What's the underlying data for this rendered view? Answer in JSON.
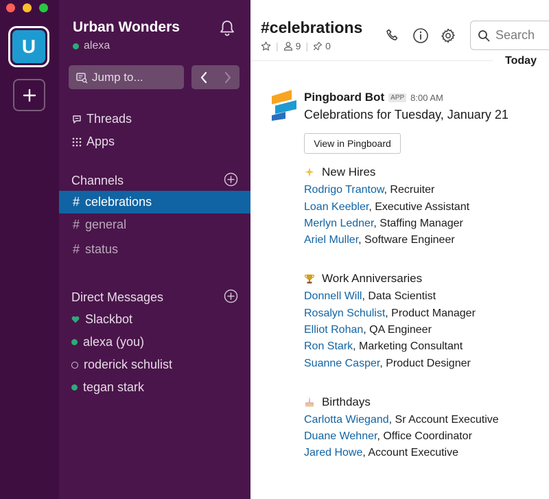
{
  "workspace": {
    "initial": "U",
    "name": "Urban Wonders",
    "user": "alexa"
  },
  "sidebar": {
    "jump_label": "Jump to...",
    "threads_label": "Threads",
    "apps_label": "Apps",
    "channels_title": "Channels",
    "channels": [
      {
        "name": "celebrations",
        "active": true
      },
      {
        "name": "general",
        "active": false
      },
      {
        "name": "status",
        "active": false
      }
    ],
    "dm_title": "Direct Messages",
    "dms": [
      {
        "name": "Slackbot",
        "status": "heart"
      },
      {
        "name": "alexa  (you)",
        "status": "online"
      },
      {
        "name": "roderick schulist",
        "status": "away"
      },
      {
        "name": "tegan stark",
        "status": "online"
      }
    ]
  },
  "channel_header": {
    "title": "#celebrations",
    "members": "9",
    "pins": "0",
    "search_placeholder": "Search",
    "today_label": "Today"
  },
  "message": {
    "sender": "Pingboard Bot",
    "badge": "APP",
    "time": "8:00 AM",
    "text": "Celebrations for Tuesday, January 21",
    "button_label": "View in Pingboard"
  },
  "sections": [
    {
      "title": "New Hires",
      "emoji": "sparkle",
      "people": [
        {
          "name": "Rodrigo Trantow",
          "role": ", Recruiter"
        },
        {
          "name": "Loan Keebler",
          "role": ", Executive Assistant"
        },
        {
          "name": "Merlyn Ledner",
          "role": ", Staffing Manager"
        },
        {
          "name": "Ariel Muller",
          "role": ", Software Engineer"
        }
      ]
    },
    {
      "title": "Work Anniversaries",
      "emoji": "trophy",
      "people": [
        {
          "name": "Donnell Will",
          "role": ", Data Scientist"
        },
        {
          "name": "Rosalyn Schulist",
          "role": ", Product Manager"
        },
        {
          "name": "Elliot  Rohan",
          "role": ", QA Engineer"
        },
        {
          "name": "Ron Stark",
          "role": ", Marketing Consultant"
        },
        {
          "name": "Suanne Casper",
          "role": ", Product Designer"
        }
      ]
    },
    {
      "title": "Birthdays",
      "emoji": "cake",
      "people": [
        {
          "name": "Carlotta Wiegand",
          "role": ", Sr Account Executive"
        },
        {
          "name": "Duane Wehner",
          "role": ", Office Coordinator"
        },
        {
          "name": "Jared Howe",
          "role": ", Account Executive"
        }
      ]
    }
  ],
  "colors": {
    "rail": "#3f0e40",
    "sidebar": "#4a154b",
    "active_channel": "#1164a3",
    "link": "#1264a3",
    "online": "#2bac76"
  }
}
